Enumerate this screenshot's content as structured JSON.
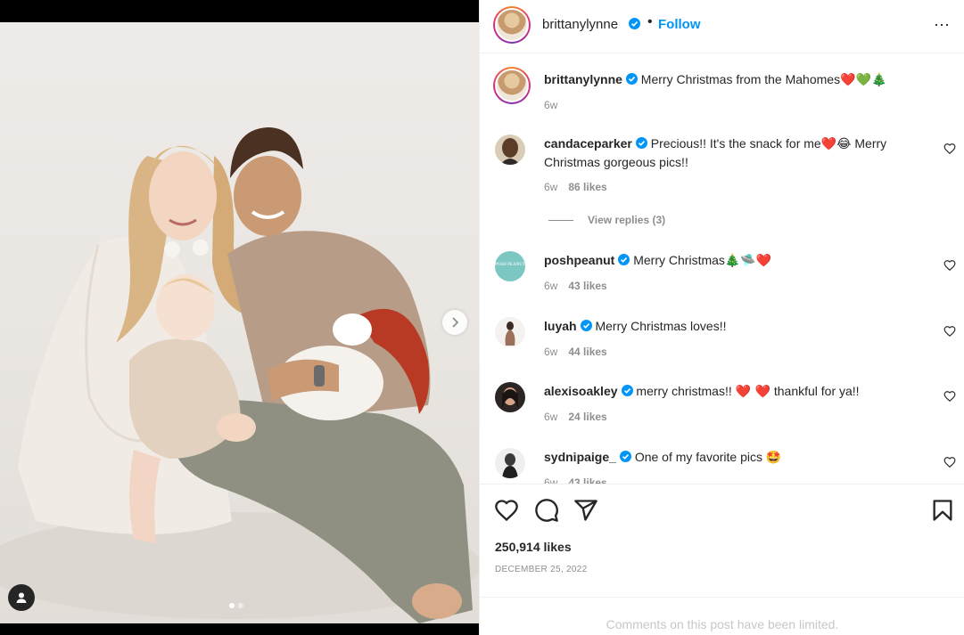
{
  "post": {
    "author": "brittanylynne",
    "follow_label": "Follow",
    "bullet": "•",
    "more_icon": "⋯",
    "caption": "Merry Christmas from the Mahomes",
    "caption_emojis": "❤️💚🎄",
    "caption_age": "6w"
  },
  "comments": [
    {
      "user": "candaceparker",
      "verified": true,
      "text": "Precious!! It's the snack for me",
      "emojis": "❤️😂",
      "text_after": " Merry Christmas gorgeous pics!!",
      "age": "6w",
      "likes": "86 likes"
    },
    {
      "user": "poshpeanut",
      "verified": true,
      "text": "Merry Christmas",
      "emojis": "🎄🛸❤️",
      "text_after": "",
      "age": "6w",
      "likes": "43 likes"
    },
    {
      "user": "luyah",
      "verified": true,
      "text": "Merry Christmas loves!!",
      "emojis": "",
      "text_after": "",
      "age": "6w",
      "likes": "44 likes"
    },
    {
      "user": "alexisoakley",
      "verified": true,
      "text": "merry christmas!! ",
      "emojis": "❤️ ❤️",
      "text_after": " thankful for ya!!",
      "age": "6w",
      "likes": "24 likes"
    },
    {
      "user": "sydnipaige_",
      "verified": true,
      "text": "One of my favorite pics ",
      "emojis": "🤩",
      "text_after": "",
      "age": "6w",
      "likes": "43 likes"
    }
  ],
  "view_replies": "View replies (3)",
  "poshpeanut_logo": "POSH PEANUT",
  "likes_total": "250,914 likes",
  "date": "DECEMBER 25, 2022",
  "comments_limited": "Comments on this post have been limited.",
  "carousel": {
    "current": 1,
    "total": 2
  },
  "icons": [
    "heart-icon",
    "comment-icon",
    "share-icon",
    "bookmark-icon",
    "chevron-right-icon",
    "user-tag-icon",
    "verified-icon"
  ],
  "colors": {
    "link": "#0095f6",
    "verified": "#0095f6",
    "muted": "#8e8e8e",
    "text": "#262626"
  }
}
